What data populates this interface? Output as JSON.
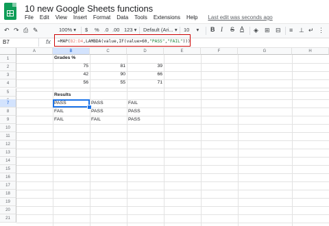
{
  "title": "10 new Google Sheets functions",
  "menu": [
    "File",
    "Edit",
    "View",
    "Insert",
    "Format",
    "Data",
    "Tools",
    "Extensions",
    "Help"
  ],
  "last_edit": "Last edit was seconds ago",
  "toolbar": {
    "zoom": "100%",
    "currency": "$",
    "percent": "%",
    "dec_decrease": ".0",
    "dec_increase": ".00",
    "more_formats": "123",
    "font": "Default (Ari...",
    "font_size": "10",
    "bold": "B",
    "italic": "I",
    "strike": "S",
    "text_color": "A"
  },
  "name_box": "B7",
  "fx": "fx",
  "formula": {
    "prefix": "=MAP(",
    "ref": "B2:D4",
    "mid": ",LAMBDA(value,IF(value>60,",
    "pass": "\"PASS\"",
    "comma": ",",
    "fail": "\"FAIL\"",
    "suffix": ")))"
  },
  "columns": [
    "A",
    "B",
    "C",
    "D",
    "E",
    "F",
    "G",
    "H"
  ],
  "rows": [
    "1",
    "2",
    "3",
    "4",
    "5",
    "6",
    "7",
    "8",
    "9",
    "10",
    "11",
    "12",
    "13",
    "14",
    "15",
    "16",
    "17",
    "18",
    "19",
    "20",
    "21"
  ],
  "cells": {
    "grades_header": "Grades %",
    "grades": [
      [
        "75",
        "81",
        "39"
      ],
      [
        "42",
        "90",
        "66"
      ],
      [
        "56",
        "55",
        "71"
      ]
    ],
    "results_header": "Results",
    "results": [
      [
        "PASS",
        "PASS",
        "FAIL"
      ],
      [
        "FAIL",
        "PASS",
        "PASS"
      ],
      [
        "FAIL",
        "FAIL",
        "PASS"
      ]
    ]
  }
}
